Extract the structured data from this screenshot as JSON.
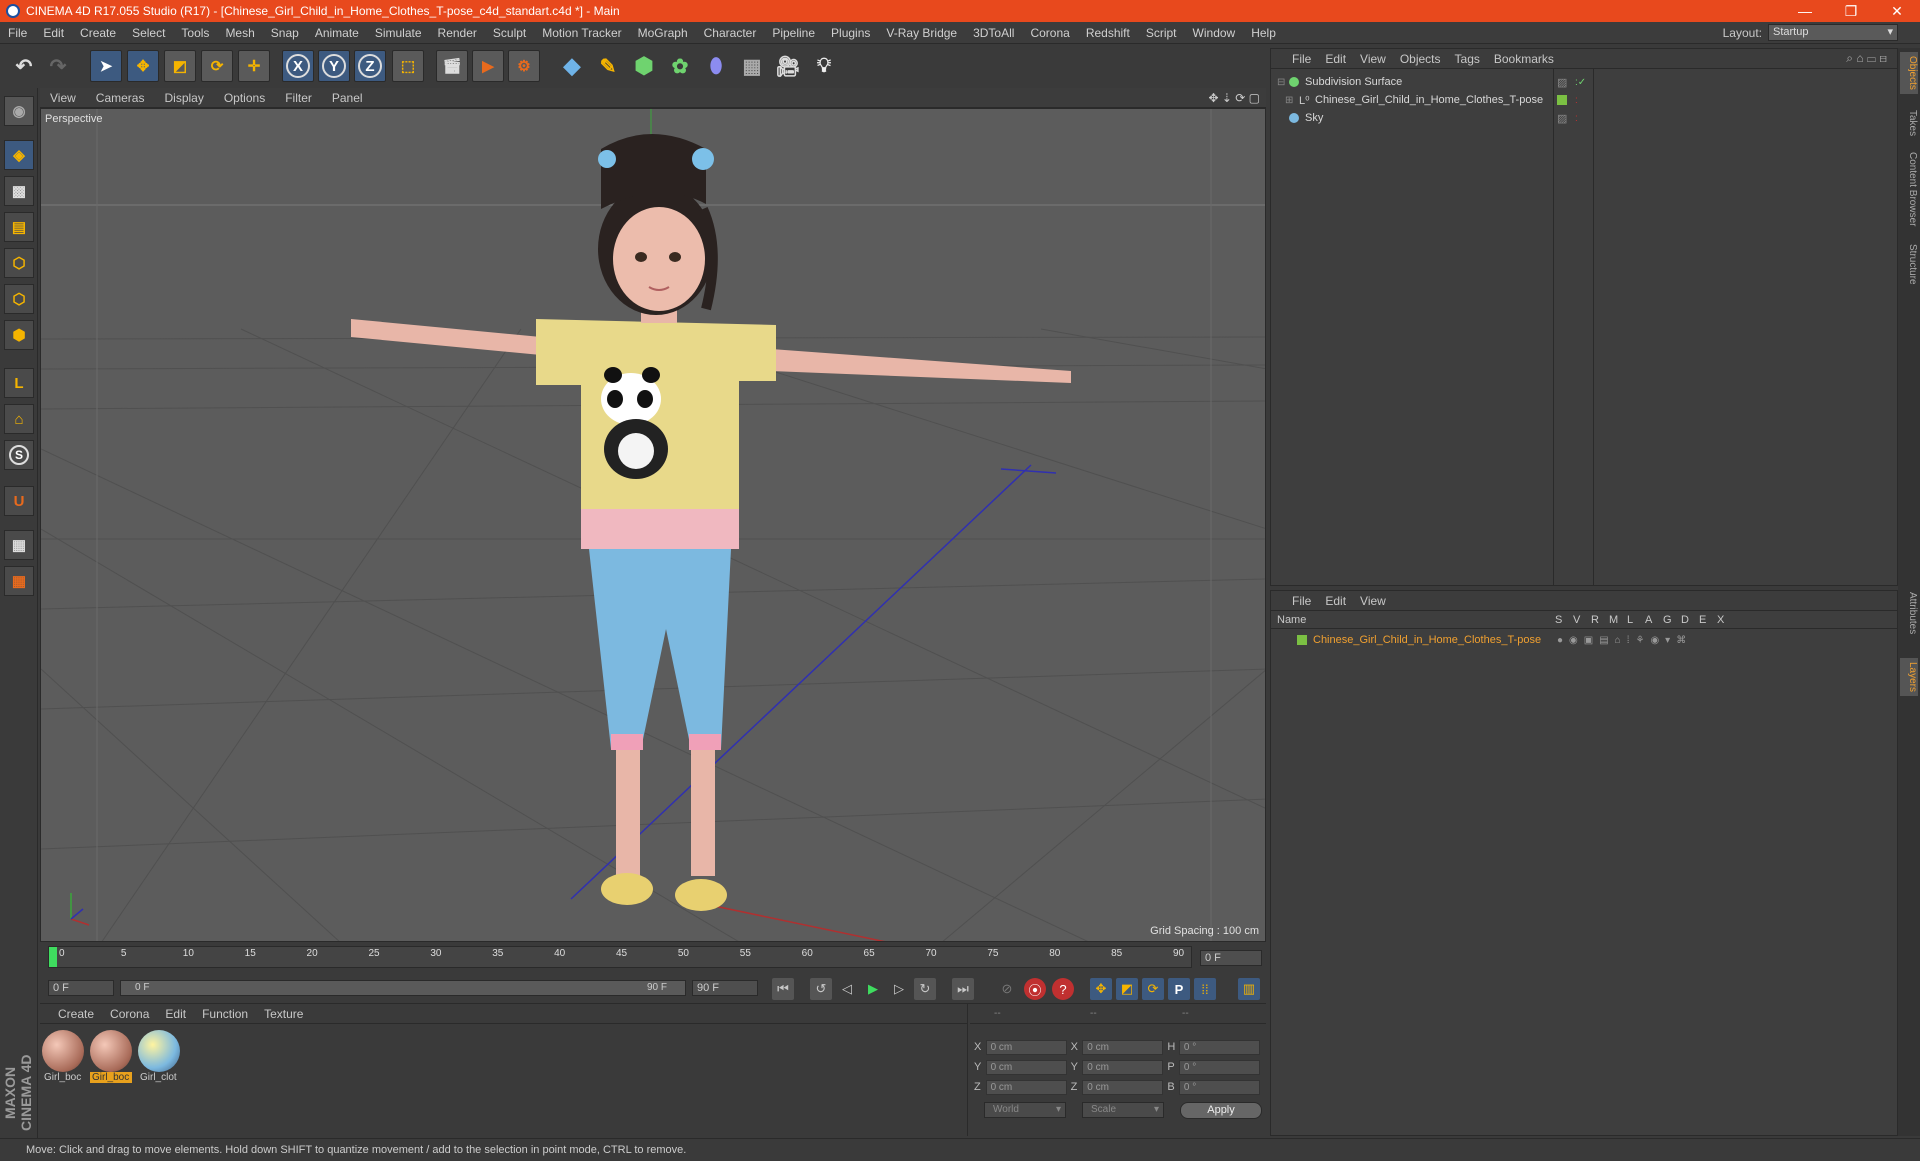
{
  "titlebar": {
    "title": "CINEMA 4D R17.055 Studio (R17) - [Chinese_Girl_Child_in_Home_Clothes_T-pose_c4d_standart.c4d *] - Main",
    "minimize": "—",
    "restore": "❐",
    "close": "✕"
  },
  "menubar": {
    "items": [
      "File",
      "Edit",
      "Create",
      "Select",
      "Tools",
      "Mesh",
      "Snap",
      "Animate",
      "Simulate",
      "Render",
      "Sculpt",
      "Motion Tracker",
      "MoGraph",
      "Character",
      "Pipeline",
      "Plugins",
      "V-Ray Bridge",
      "3DToAll",
      "Corona",
      "Redshift",
      "Script",
      "Window",
      "Help"
    ],
    "layout_label": "Layout:",
    "layout_value": "Startup"
  },
  "toolbar": {
    "x_label": "X",
    "y_label": "Y",
    "z_label": "Z"
  },
  "viewport": {
    "menu": [
      "View",
      "Cameras",
      "Display",
      "Options",
      "Filter",
      "Panel"
    ],
    "label": "Perspective",
    "grid_spacing": "Grid Spacing : 100 cm"
  },
  "timeline": {
    "ticks": [
      "0",
      "5",
      "10",
      "15",
      "20",
      "25",
      "30",
      "35",
      "40",
      "45",
      "50",
      "55",
      "60",
      "65",
      "70",
      "75",
      "80",
      "85",
      "90"
    ],
    "current_frame": "0 F",
    "start_field": "0 F",
    "range_start": "0 F",
    "range_end": "90 F",
    "end_field": "90 F"
  },
  "material_manager": {
    "menu": [
      "Create",
      "Corona",
      "Edit",
      "Function",
      "Texture"
    ],
    "materials": [
      {
        "label": "Girl_boc",
        "selected": false
      },
      {
        "label": "Girl_boc",
        "selected": true
      },
      {
        "label": "Girl_clot",
        "selected": false
      }
    ]
  },
  "coordinates": {
    "headers": [
      "--",
      "--",
      "--"
    ],
    "rows": [
      {
        "l1": "X",
        "v1": "0 cm",
        "l2": "X",
        "v2": "0 cm",
        "l3": "H",
        "v3": "0 °"
      },
      {
        "l1": "Y",
        "v1": "0 cm",
        "l2": "Y",
        "v2": "0 cm",
        "l3": "P",
        "v3": "0 °"
      },
      {
        "l1": "Z",
        "v1": "0 cm",
        "l2": "Z",
        "v2": "0 cm",
        "l3": "B",
        "v3": "0 °"
      }
    ],
    "world": "World",
    "scale": "Scale",
    "apply": "Apply"
  },
  "object_manager": {
    "menu": [
      "File",
      "Edit",
      "View",
      "Objects",
      "Tags",
      "Bookmarks"
    ],
    "objects": [
      {
        "name": "Subdivision Surface"
      },
      {
        "name": "Chinese_Girl_Child_in_Home_Clothes_T-pose"
      },
      {
        "name": "Sky"
      }
    ]
  },
  "layer_manager": {
    "menu": [
      "File",
      "Edit",
      "View"
    ],
    "name_header": "Name",
    "columns": [
      "S",
      "V",
      "R",
      "M",
      "L",
      "A",
      "G",
      "D",
      "E",
      "X"
    ],
    "layers": [
      {
        "name": "Chinese_Girl_Child_in_Home_Clothes_T-pose",
        "color": "#7bc043"
      }
    ]
  },
  "right_tabs": {
    "objects": "Objects",
    "takes": "Takes",
    "content_browser": "Content Browser",
    "structure": "Structure",
    "attributes": "Attributes",
    "layers": "Layers"
  },
  "maxon_logo": "MAXON CINEMA 4D",
  "statusbar": {
    "text": "Move: Click and drag to move elements. Hold down SHIFT to quantize movement / add to the selection in point mode, CTRL to remove."
  },
  "colors": {
    "titlebar": "#e8491d",
    "accent_orange": "#e8a11d",
    "viewport_bg": "#5c5c5c",
    "panel_bg": "#3a3a3a"
  }
}
